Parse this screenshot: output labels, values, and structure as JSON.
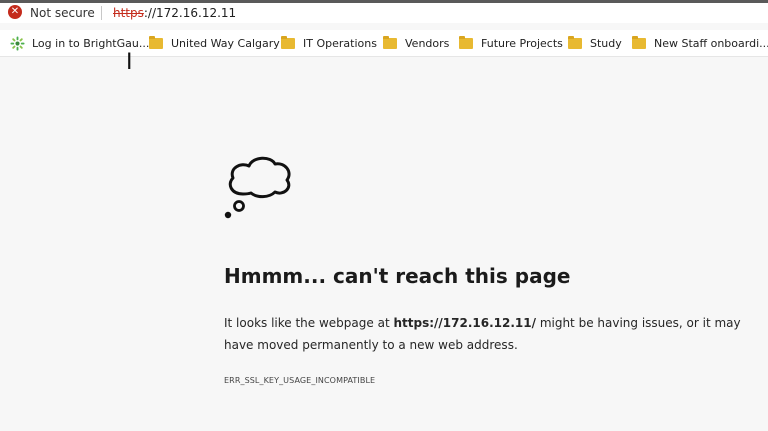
{
  "address_bar": {
    "security_label": "Not secure",
    "url_scheme": "https",
    "url_rest": "://172.16.12.11"
  },
  "bookmarks": [
    {
      "label": "Log in to BrightGau...",
      "icon": "brightgauge-logo-icon"
    },
    {
      "label": "United Way Calgary",
      "icon": "folder-icon"
    },
    {
      "label": "IT Operations",
      "icon": "folder-icon"
    },
    {
      "label": "Vendors",
      "icon": "folder-icon"
    },
    {
      "label": "Future Projects",
      "icon": "folder-icon"
    },
    {
      "label": "Study",
      "icon": "folder-icon"
    },
    {
      "label": "New Staff onboardi...",
      "icon": "folder-icon"
    }
  ],
  "error_page": {
    "title": "Hmmm... can't reach this page",
    "desc_before": "It looks like the webpage at ",
    "desc_url": "https://172.16.12.11/",
    "desc_after": " might be having issues, or it may have moved permanently to a new web address.",
    "error_code": "ERR_SSL_KEY_USAGE_INCOMPATIBLE"
  },
  "colors": {
    "security_red": "#c42b1c",
    "folder_yellow": "#e8b931"
  }
}
